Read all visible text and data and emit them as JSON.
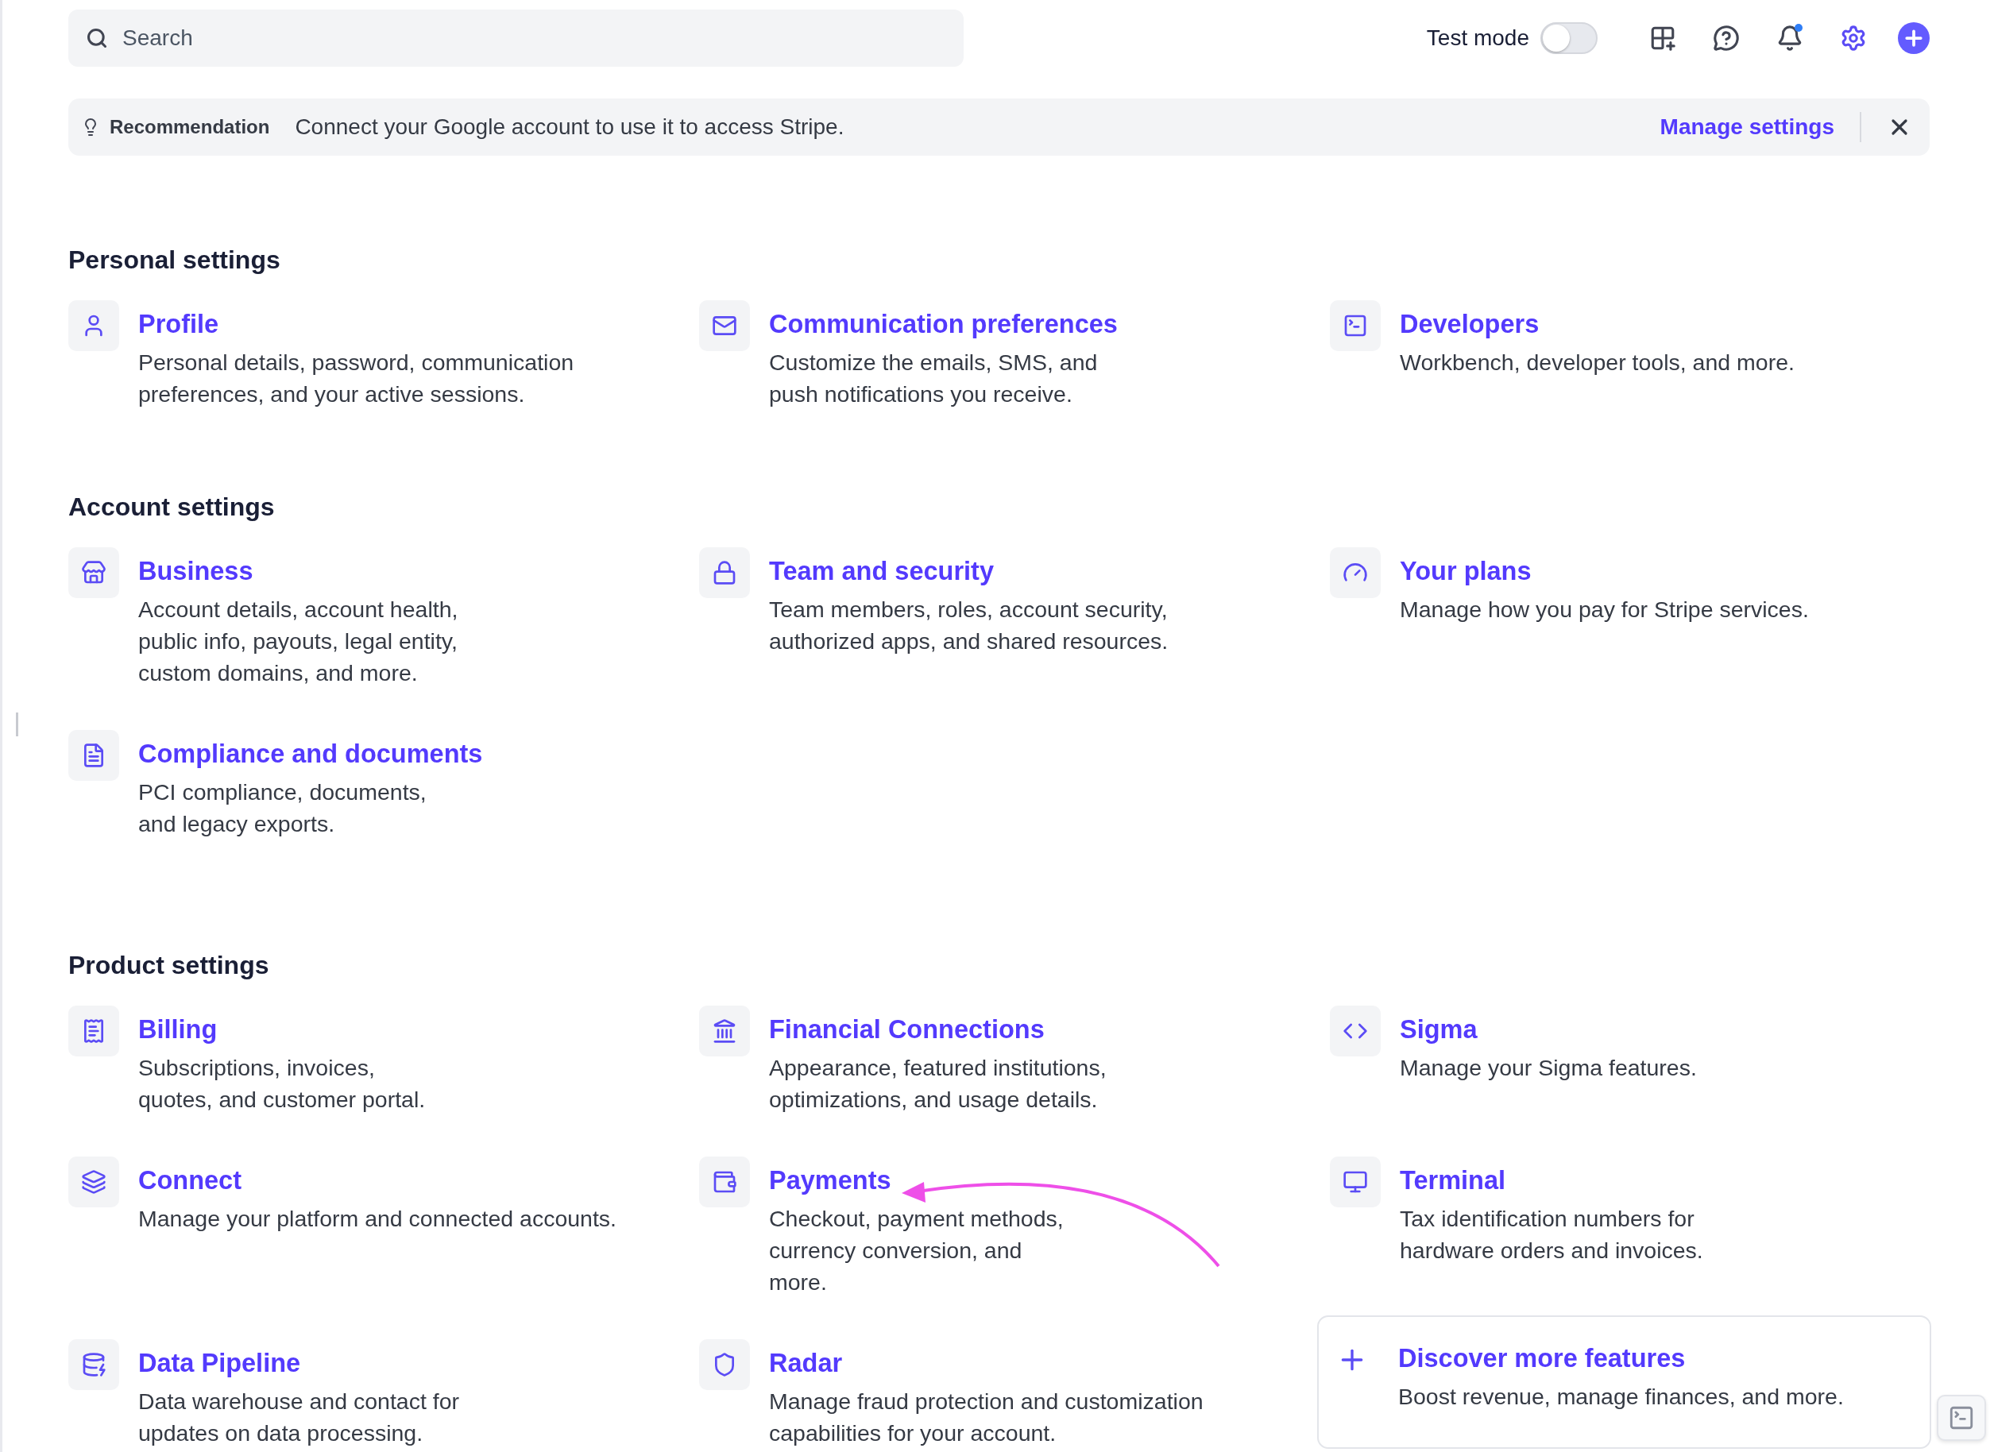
{
  "topbar": {
    "search": {
      "placeholder": "Search"
    },
    "test_mode": {
      "label": "Test mode",
      "on": false
    },
    "notifications": {
      "unread": true
    }
  },
  "banner": {
    "label": "Recommendation",
    "message": "Connect your Google account to use it to access Stripe.",
    "action": "Manage settings"
  },
  "sections": [
    {
      "title": "Personal settings",
      "items": [
        {
          "kind": "link",
          "title": "Profile",
          "description": "Personal details, password, communication preferences, and your active sessions."
        },
        {
          "kind": "link",
          "title": "Communication preferences",
          "description": "Customize the emails, SMS, and push notifications you receive."
        },
        {
          "kind": "link",
          "title": "Developers",
          "description": "Workbench, developer tools, and more."
        }
      ]
    },
    {
      "title": "Account settings",
      "items": [
        {
          "kind": "link",
          "title": "Business",
          "description": "Account details, account health, public info, payouts, legal entity, custom domains, and more."
        },
        {
          "kind": "link",
          "title": "Team and security",
          "description": "Team members, roles, account security, authorized apps, and shared resources."
        },
        {
          "kind": "link",
          "title": "Your plans",
          "description": "Manage how you pay for Stripe services."
        },
        {
          "kind": "link",
          "title": "Compliance and documents",
          "description": "PCI compliance, documents, and legacy exports."
        }
      ]
    },
    {
      "title": "Product settings",
      "items": [
        {
          "kind": "link",
          "title": "Billing",
          "description": "Subscriptions, invoices, quotes, and customer portal."
        },
        {
          "kind": "link",
          "title": "Financial Connections",
          "description": "Appearance, featured institutions, optimizations, and usage details."
        },
        {
          "kind": "link",
          "title": "Sigma",
          "description": "Manage your Sigma features."
        },
        {
          "kind": "link",
          "title": "Connect",
          "description": "Manage your platform and connected accounts."
        },
        {
          "kind": "link",
          "title": "Payments",
          "description": "Checkout, payment methods, currency conversion, and more."
        },
        {
          "kind": "link",
          "title": "Terminal",
          "description": "Tax identification numbers for hardware orders and invoices."
        },
        {
          "kind": "link",
          "title": "Data Pipeline",
          "description": "Data warehouse and contact for updates on data processing."
        },
        {
          "kind": "link",
          "title": "Radar",
          "description": "Manage fraud protection and customization capabilities for your account."
        },
        {
          "kind": "card",
          "title": "Discover more features",
          "description": "Boost revenue, manage finances, and more."
        }
      ]
    }
  ]
}
